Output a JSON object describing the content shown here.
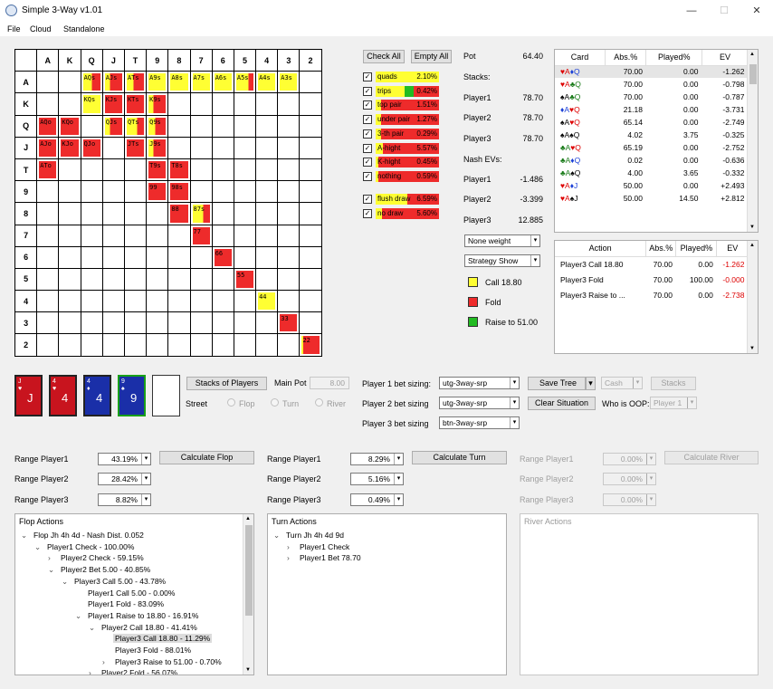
{
  "window": {
    "title": "Simple 3-Way v1.01",
    "minimize": "—",
    "maximize": "☐",
    "close": "✕"
  },
  "menu": [
    "File",
    "Cloud",
    "Standalone"
  ],
  "grid": {
    "ranks": [
      "A",
      "K",
      "Q",
      "J",
      "T",
      "9",
      "8",
      "7",
      "6",
      "5",
      "4",
      "3",
      "2"
    ],
    "cells": [
      {
        "r": 0,
        "c": 2,
        "t": "AQs",
        "y": 0.5
      },
      {
        "r": 0,
        "c": 3,
        "t": "AJs",
        "y": 0.3
      },
      {
        "r": 0,
        "c": 4,
        "t": "ATs",
        "y": 0.4
      },
      {
        "r": 0,
        "c": 5,
        "t": "A9s",
        "y": 1
      },
      {
        "r": 0,
        "c": 6,
        "t": "A8s",
        "y": 1
      },
      {
        "r": 0,
        "c": 7,
        "t": "A7s",
        "y": 1
      },
      {
        "r": 0,
        "c": 8,
        "t": "A6s",
        "y": 1
      },
      {
        "r": 0,
        "c": 9,
        "t": "A5s",
        "y": 0.7
      },
      {
        "r": 0,
        "c": 10,
        "t": "A4s",
        "y": 1,
        "g": 0.3
      },
      {
        "r": 0,
        "c": 11,
        "t": "A3s",
        "y": 1
      },
      {
        "r": 1,
        "c": 2,
        "t": "KQs",
        "y": 1
      },
      {
        "r": 1,
        "c": 3,
        "t": "KJs",
        "y": 0
      },
      {
        "r": 1,
        "c": 4,
        "t": "KTs",
        "y": 0
      },
      {
        "r": 1,
        "c": 5,
        "t": "K9s",
        "y": 0.3
      },
      {
        "r": 2,
        "c": 0,
        "t": "AQo",
        "y": 0
      },
      {
        "r": 2,
        "c": 1,
        "t": "KQo",
        "y": 0
      },
      {
        "r": 2,
        "c": 3,
        "t": "QJs",
        "y": 0.3
      },
      {
        "r": 2,
        "c": 4,
        "t": "QTs",
        "y": 0.6
      },
      {
        "r": 2,
        "c": 5,
        "t": "Q9s",
        "y": 0.4
      },
      {
        "r": 3,
        "c": 0,
        "t": "AJo",
        "y": 0
      },
      {
        "r": 3,
        "c": 1,
        "t": "KJo",
        "y": 0
      },
      {
        "r": 3,
        "c": 2,
        "t": "QJo",
        "y": 0
      },
      {
        "r": 3,
        "c": 4,
        "t": "JTs",
        "y": 0
      },
      {
        "r": 3,
        "c": 5,
        "t": "J9s",
        "y": 0.3
      },
      {
        "r": 4,
        "c": 0,
        "t": "ATo",
        "y": 0
      },
      {
        "r": 4,
        "c": 5,
        "t": "T9s",
        "y": 0
      },
      {
        "r": 4,
        "c": 6,
        "t": "T8s",
        "y": 0
      },
      {
        "r": 5,
        "c": 5,
        "t": "99",
        "y": 0
      },
      {
        "r": 5,
        "c": 6,
        "t": "98s",
        "y": 0
      },
      {
        "r": 6,
        "c": 6,
        "t": "88",
        "y": 0
      },
      {
        "r": 6,
        "c": 7,
        "t": "87s",
        "y": 0.6
      },
      {
        "r": 7,
        "c": 7,
        "t": "77",
        "y": 0
      },
      {
        "r": 8,
        "c": 8,
        "t": "66",
        "y": 0
      },
      {
        "r": 9,
        "c": 9,
        "t": "55",
        "y": 0
      },
      {
        "r": 10,
        "c": 10,
        "t": "44",
        "y": 1
      },
      {
        "r": 11,
        "c": 11,
        "t": "33",
        "y": 0
      },
      {
        "r": 12,
        "c": 12,
        "t": "22",
        "y": 0.1
      }
    ]
  },
  "filters": {
    "check_all": "Check All",
    "empty_all": "Empty All",
    "items": [
      {
        "label": "quads",
        "pct": "2.10%",
        "color": "#ffff33",
        "fill": 1.0,
        "checked": true
      },
      {
        "label": "trips",
        "pct": "0.42%",
        "color": "#22bb22",
        "fill": 0.6,
        "yellow": 0.45,
        "checked": true
      },
      {
        "label": "top pair",
        "pct": "1.51%",
        "color": "#ffff33",
        "fill": 0.08,
        "checked": true
      },
      {
        "label": "under pair",
        "pct": "1.27%",
        "color": "#ffff33",
        "fill": 0.08,
        "checked": true
      },
      {
        "label": "3-th pair",
        "pct": "0.29%",
        "color": "#ffff33",
        "fill": 0.08,
        "checked": true
      },
      {
        "label": "A-hight",
        "pct": "5.57%",
        "color": "#ffff33",
        "fill": 0.12,
        "checked": true
      },
      {
        "label": "K-hight",
        "pct": "0.45%",
        "color": "#ffff33",
        "fill": 0.04,
        "checked": true
      },
      {
        "label": "nothing",
        "pct": "0.59%",
        "color": "#ffff33",
        "fill": 0.04,
        "checked": true
      }
    ],
    "items2": [
      {
        "label": "flush draw",
        "pct": "6.59%",
        "color": "#ffff33",
        "fill": 0.5,
        "checked": true
      },
      {
        "label": "no draw",
        "pct": "5.60%",
        "color": "#ffff33",
        "fill": 0.1,
        "checked": true
      }
    ]
  },
  "stats": {
    "pot_label": "Pot",
    "pot": "64.40",
    "stacks_label": "Stacks:",
    "p1": "Player1",
    "p1v": "78.70",
    "p2": "Player2",
    "p2v": "78.70",
    "p3": "Player3",
    "p3v": "78.70",
    "nash_label": "Nash EVs:",
    "n1": "Player1",
    "n1v": "-1.486",
    "n2": "Player2",
    "n2v": "-3.399",
    "n3": "Player3",
    "n3v": "12.885",
    "weight": "None weight",
    "strategy": "Strategy Show"
  },
  "legend": [
    {
      "label": "Call 18.80",
      "color": "#ffff33"
    },
    {
      "label": "Fold",
      "color": "#ee2b2b"
    },
    {
      "label": "Raise to 51.00",
      "color": "#22bb22"
    }
  ],
  "card_table": {
    "headers": [
      "Card",
      "Abs.%",
      "Played%",
      "EV"
    ],
    "rows": [
      {
        "c1": "♥A",
        "c2": "♦Q",
        "c1c": "#d00",
        "c2c": "#1a3fd6",
        "abs": "70.00",
        "pl": "0.00",
        "ev": "-1.262",
        "sel": true
      },
      {
        "c1": "♥A",
        "c2": "♣Q",
        "c1c": "#d00",
        "c2c": "#187a18",
        "abs": "70.00",
        "pl": "0.00",
        "ev": "-0.798"
      },
      {
        "c1": "♠A",
        "c2": "♣Q",
        "c1c": "#000",
        "c2c": "#187a18",
        "abs": "70.00",
        "pl": "0.00",
        "ev": "-0.787"
      },
      {
        "c1": "♦A",
        "c2": "♥Q",
        "c1c": "#1a3fd6",
        "c2c": "#d00",
        "abs": "21.18",
        "pl": "0.00",
        "ev": "-3.731"
      },
      {
        "c1": "♠A",
        "c2": "♥Q",
        "c1c": "#000",
        "c2c": "#d00",
        "abs": "65.14",
        "pl": "0.00",
        "ev": "-2.749"
      },
      {
        "c1": "♠A",
        "c2": "♠Q",
        "c1c": "#000",
        "c2c": "#000",
        "abs": "4.02",
        "pl": "3.75",
        "ev": "-0.325"
      },
      {
        "c1": "♣A",
        "c2": "♥Q",
        "c1c": "#187a18",
        "c2c": "#d00",
        "abs": "65.19",
        "pl": "0.00",
        "ev": "-2.752"
      },
      {
        "c1": "♣A",
        "c2": "♦Q",
        "c1c": "#187a18",
        "c2c": "#1a3fd6",
        "abs": "0.02",
        "pl": "0.00",
        "ev": "-0.636"
      },
      {
        "c1": "♣A",
        "c2": "♠Q",
        "c1c": "#187a18",
        "c2c": "#000",
        "abs": "4.00",
        "pl": "3.65",
        "ev": "-0.332"
      },
      {
        "c1": "♥A",
        "c2": "♦J",
        "c1c": "#d00",
        "c2c": "#1a3fd6",
        "abs": "50.00",
        "pl": "0.00",
        "ev": "+2.493"
      },
      {
        "c1": "♥A",
        "c2": "♠J",
        "c1c": "#d00",
        "c2c": "#000",
        "abs": "50.00",
        "pl": "14.50",
        "ev": "+2.812"
      }
    ]
  },
  "action_table": {
    "headers": [
      "Action",
      "Abs.%",
      "Played%",
      "EV"
    ],
    "rows": [
      {
        "a": "Player3 Call 18.80",
        "abs": "70.00",
        "pl": "0.00",
        "ev": "-1.262"
      },
      {
        "a": "Player3 Fold",
        "abs": "70.00",
        "pl": "100.00",
        "ev": "-0.000"
      },
      {
        "a": "Player3 Raise to ...",
        "abs": "70.00",
        "pl": "0.00",
        "ev": "-2.738"
      }
    ]
  },
  "board": [
    {
      "rank": "J",
      "suit": "♥",
      "bg": "#c8141e"
    },
    {
      "rank": "4",
      "suit": "♥",
      "bg": "#c8141e"
    },
    {
      "rank": "4",
      "suit": "♦",
      "bg": "#1a2fa8"
    },
    {
      "rank": "9",
      "suit": "♠",
      "bg": "#1a2fa8",
      "border": "#19a019"
    }
  ],
  "controls": {
    "stacks_btn": "Stacks of Players",
    "main_pot_label": "Main Pot",
    "main_pot": "8.00",
    "street_label": "Street",
    "flop": "Flop",
    "turn": "Turn",
    "river": "River",
    "b1_label": "Player 1 bet sizing:",
    "b1": "utg-3way-srp",
    "b2_label": "Player 2 bet sizing",
    "b2": "utg-3way-srp",
    "b3_label": "Player 3 bet sizing",
    "b3": "btn-3way-srp",
    "save_tree": "Save Tree",
    "clear": "Clear Situation",
    "cash": "Cash",
    "stacks": "Stacks",
    "oop_label": "Who is OOP:",
    "oop": "Player 1"
  },
  "ranges": {
    "flop": {
      "p1": "Range Player1",
      "v1": "43.19%",
      "p2": "Range Player2",
      "v2": "28.42%",
      "p3": "Range Player3",
      "v3": "8.82%",
      "btn": "Calculate Flop"
    },
    "turn": {
      "p1": "Range Player1",
      "v1": "8.29%",
      "p2": "Range Player2",
      "v2": "5.16%",
      "p3": "Range Player3",
      "v3": "0.49%",
      "btn": "Calculate Turn"
    },
    "river": {
      "p1": "Range Player1",
      "v1": "0.00%",
      "p2": "Range Player2",
      "v2": "0.00%",
      "p3": "Range Player3",
      "v3": "0.00%",
      "btn": "Calculate River"
    }
  },
  "flop_actions": {
    "title": "Flop Actions",
    "lines": [
      {
        "t": "Flop Jh 4h 4d - Nash Dist. 0.052",
        "lvl": 0,
        "exp": "v"
      },
      {
        "t": "Player1 Check - 100.00%",
        "lvl": 1,
        "exp": "v"
      },
      {
        "t": "Player2 Check - 59.15%",
        "lvl": 2,
        "exp": ">"
      },
      {
        "t": "Player2 Bet 5.00 - 40.85%",
        "lvl": 2,
        "exp": "v"
      },
      {
        "t": "Player3 Call 5.00 - 43.78%",
        "lvl": 3,
        "exp": "v"
      },
      {
        "t": "Player1 Call 5.00 - 0.00%",
        "lvl": 4,
        "exp": ""
      },
      {
        "t": "Player1 Fold - 83.09%",
        "lvl": 4,
        "exp": ""
      },
      {
        "t": "Player1 Raise to 18.80 - 16.91%",
        "lvl": 4,
        "exp": "v"
      },
      {
        "t": "Player2 Call 18.80 - 41.41%",
        "lvl": 5,
        "exp": "v"
      },
      {
        "t": "Player3 Call 18.80 - 11.29%",
        "lvl": 6,
        "exp": "",
        "hl": true
      },
      {
        "t": "Player3 Fold - 88.01%",
        "lvl": 6,
        "exp": ""
      },
      {
        "t": "Player3 Raise to 51.00 - 0.70%",
        "lvl": 6,
        "exp": ">"
      },
      {
        "t": "Player2 Fold - 56.07%",
        "lvl": 5,
        "exp": ">"
      }
    ]
  },
  "turn_actions": {
    "title": "Turn Actions",
    "lines": [
      {
        "t": "Turn Jh 4h 4d 9d",
        "lvl": 0,
        "exp": "v"
      },
      {
        "t": "Player1 Check",
        "lvl": 1,
        "exp": ">"
      },
      {
        "t": "Player1 Bet 78.70",
        "lvl": 1,
        "exp": ">"
      }
    ]
  },
  "river_actions": {
    "title": "River Actions"
  }
}
